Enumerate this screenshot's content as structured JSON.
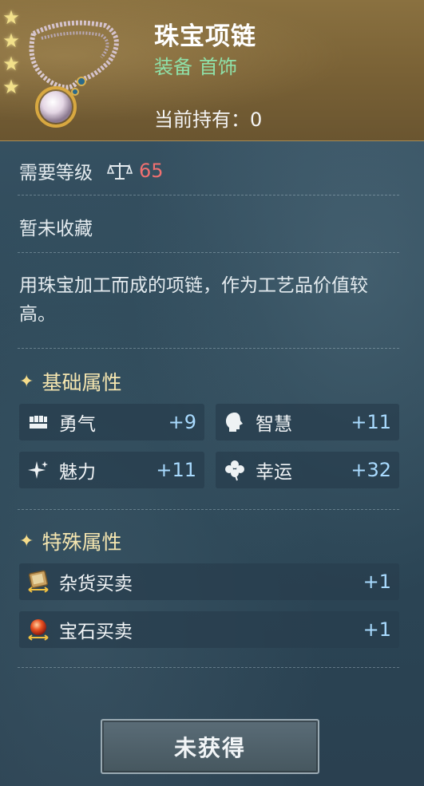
{
  "item": {
    "name": "珠宝项链",
    "type_category": "装备",
    "type_slot": "首饰",
    "held_label": "当前持有：",
    "held_count": "0",
    "rarity_stars": 4
  },
  "requirements": {
    "level_label": "需要等级",
    "level_icon": "scale-icon",
    "level_value": "65"
  },
  "collection_status": "暂未收藏",
  "description": "用珠宝加工而成的项链，作为工艺品价值较高。",
  "basic_attributes": {
    "title": "基础属性",
    "items": [
      {
        "icon": "fist-icon",
        "label": "勇气",
        "value": "+9"
      },
      {
        "icon": "head-icon",
        "label": "智慧",
        "value": "+11"
      },
      {
        "icon": "sparkle-icon",
        "label": "魅力",
        "value": "+11"
      },
      {
        "icon": "clover-icon",
        "label": "幸运",
        "value": "+32"
      }
    ]
  },
  "special_attributes": {
    "title": "特殊属性",
    "items": [
      {
        "icon": "goods-trade-icon",
        "label": "杂货买卖",
        "value": "+1"
      },
      {
        "icon": "gem-trade-icon",
        "label": "宝石买卖",
        "value": "+1"
      }
    ]
  },
  "action_button": {
    "label": "未获得"
  },
  "colors": {
    "header_gold": "#7a6236",
    "type_green": "#8fe0a8",
    "level_red": "#f07070",
    "section_title": "#f5e6b0",
    "attr_value": "#a9dbff"
  }
}
